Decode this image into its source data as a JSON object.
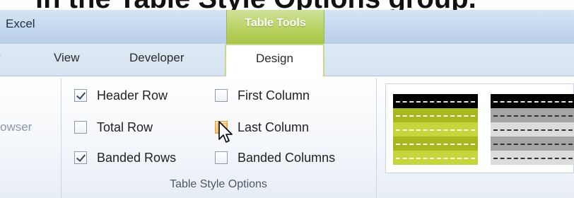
{
  "caption": "in the Table Style Options group.",
  "title_bar": {
    "app_title": "Excel",
    "context_tab": "Table Tools"
  },
  "tabs": {
    "partial": "v",
    "view": "View",
    "developer": "Developer",
    "design": "Design"
  },
  "left_group_partial": "owser",
  "table_style_options": {
    "group_label": "Table Style Options",
    "options": [
      {
        "label": "Header Row",
        "checked": true
      },
      {
        "label": "Total Row",
        "checked": false
      },
      {
        "label": "Banded Rows",
        "checked": true
      },
      {
        "label": "First Column",
        "checked": false
      },
      {
        "label": "Last Column",
        "checked": false,
        "hovered": true
      },
      {
        "label": "Banded Columns",
        "checked": false
      }
    ]
  },
  "table_styles_gallery": {
    "styles": [
      {
        "name": "green-style",
        "header_color": "#000000",
        "band_color": "#a7b91e",
        "alt_color": "#c5d63c"
      },
      {
        "name": "gray-style",
        "header_color": "#000000",
        "band_color": "#a5a5a5",
        "alt_color": "#dcdcdc"
      }
    ]
  },
  "colors": {
    "context_tab": "#b6d15e",
    "checkbox_hover": "#f7c46a"
  }
}
